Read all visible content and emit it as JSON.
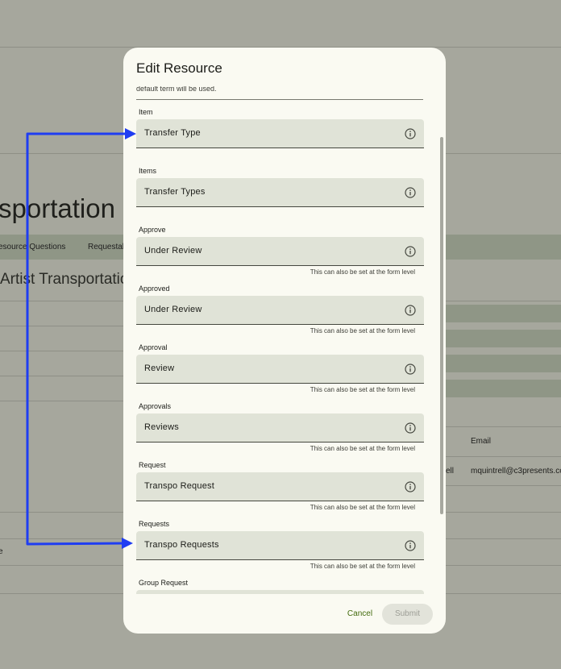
{
  "background": {
    "title": "sportation",
    "tabs": [
      "esource Questions",
      "Requestab"
    ],
    "subtitle": "Artist Transportatio",
    "table_header_email": "Email",
    "table_cell_left": "ell",
    "table_cell_email": "mquintrell@c3presents.co",
    "row_fragment": "e"
  },
  "dialog": {
    "title": "Edit Resource",
    "cut_text": "default term will be used.",
    "fields": [
      {
        "label": "Item",
        "value": "Transfer Type",
        "help": ""
      },
      {
        "label": "Items",
        "value": "Transfer Types",
        "help": ""
      },
      {
        "label": "Approve",
        "value": "Under Review",
        "help": "This can also be set at the form level"
      },
      {
        "label": "Approved",
        "value": "Under Review",
        "help": "This can also be set at the form level"
      },
      {
        "label": "Approval",
        "value": "Review",
        "help": "This can also be set at the form level"
      },
      {
        "label": "Approvals",
        "value": "Reviews",
        "help": "This can also be set at the form level"
      },
      {
        "label": "Request",
        "value": "Transpo Request",
        "help": "This can also be set at the form level"
      },
      {
        "label": "Requests",
        "value": "Transpo Requests",
        "help": "This can also be set at the form level"
      },
      {
        "label": "Group Request",
        "value": "",
        "help": ""
      }
    ],
    "cancel_label": "Cancel",
    "submit_label": "Submit"
  },
  "colors": {
    "overlay": "#a6a79d",
    "dialog_bg": "#fafaf2",
    "field_bg": "#e0e3d7",
    "accent_green": "#436b0d",
    "annotation_arrow": "#1f3df2"
  },
  "icons": {
    "field_trailing": "info-circle-icon"
  }
}
